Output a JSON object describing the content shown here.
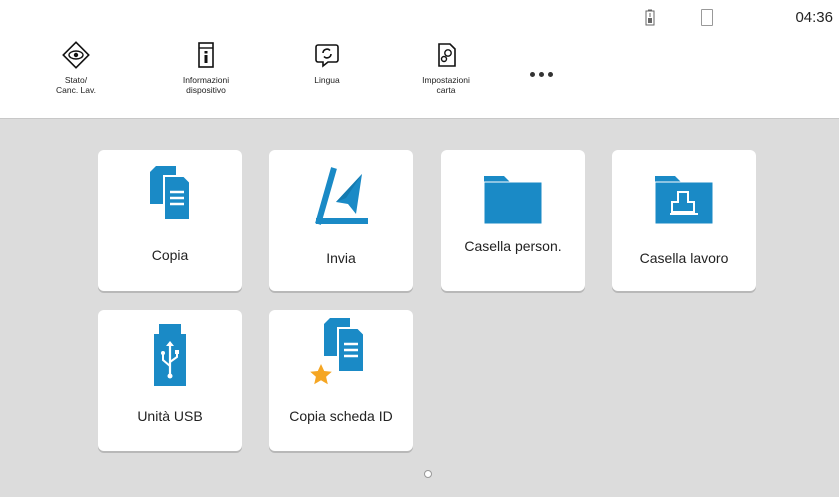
{
  "status": {
    "time": "04:36"
  },
  "toolbar": {
    "items": [
      {
        "label": "Stato/\nCanc. Lav.",
        "icon": "eye-diamond-icon"
      },
      {
        "label": "Informazioni\ndispositivo",
        "icon": "device-info-icon"
      },
      {
        "label": "Lingua",
        "icon": "language-icon"
      },
      {
        "label": "Impostazioni\ncarta",
        "icon": "paper-settings-icon"
      }
    ],
    "more_icon": "more-dots-icon"
  },
  "tiles": [
    {
      "label": "Copia",
      "icon": "copy-icon"
    },
    {
      "label": "Invia",
      "icon": "send-icon"
    },
    {
      "label": "Casella person.",
      "icon": "folder-icon"
    },
    {
      "label": "Casella lavoro",
      "icon": "job-box-folder-icon"
    },
    {
      "label": "Unità USB",
      "icon": "usb-icon"
    },
    {
      "label": "Copia scheda ID",
      "icon": "id-card-copy-icon"
    }
  ],
  "colors": {
    "accent": "#1a8ac6",
    "star": "#f5a623",
    "background": "#dcdcdc"
  }
}
